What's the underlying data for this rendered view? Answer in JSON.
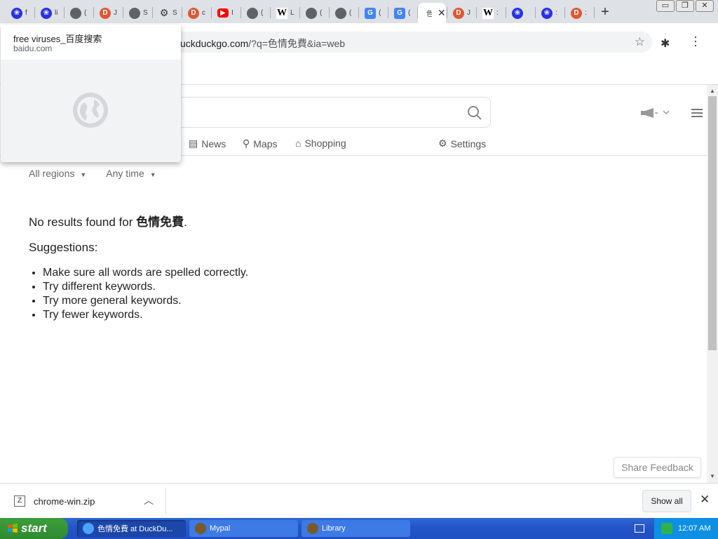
{
  "tabs": [
    {
      "icon": "baidu-paw-icon",
      "title": "f"
    },
    {
      "icon": "baidu-paw-icon",
      "title": "li"
    },
    {
      "icon": "globe-icon",
      "title": "("
    },
    {
      "icon": "duckduckgo-icon",
      "title": "J"
    },
    {
      "icon": "globe-icon",
      "title": "S"
    },
    {
      "icon": "gear-icon",
      "title": "S"
    },
    {
      "icon": "duckduckgo-icon",
      "title": "c"
    },
    {
      "icon": "youtube-icon",
      "title": "I"
    },
    {
      "icon": "globe-icon",
      "title": "("
    },
    {
      "icon": "wikipedia-icon",
      "title": "L"
    },
    {
      "icon": "globe-icon",
      "title": "("
    },
    {
      "icon": "globe-icon",
      "title": "("
    },
    {
      "icon": "google-translate-icon",
      "title": "("
    },
    {
      "icon": "google-translate-icon",
      "title": "("
    },
    {
      "icon": "active-tab",
      "title": "色"
    },
    {
      "icon": "duckduckgo-icon",
      "title": "J"
    },
    {
      "icon": "wikipedia-icon",
      "title": ":"
    },
    {
      "icon": "baidu-paw-icon",
      "title": ""
    },
    {
      "icon": "baidu-paw-icon",
      "title": ":"
    },
    {
      "icon": "duckduckgo-icon",
      "title": ":"
    }
  ],
  "window_controls": {
    "minimize": "▭",
    "restore": "❐",
    "close": "✕"
  },
  "omnibox": {
    "host": "uckduckgo.com",
    "path": "/?q=色情免費&ia=web"
  },
  "hover_card": {
    "title": "free viruses_百度搜索",
    "host": "baidu.com"
  },
  "nav": {
    "news": "News",
    "maps": "Maps",
    "shopping": "Shopping",
    "settings": "Settings"
  },
  "filters": {
    "region": "All regions",
    "time": "Any time"
  },
  "results": {
    "no_results_prefix": "No results found for ",
    "query": "色情免費",
    "no_results_suffix": ".",
    "suggestions_heading": "Suggestions:",
    "suggestions": [
      "Make sure all words are spelled correctly.",
      "Try different keywords.",
      "Try more general keywords.",
      "Try fewer keywords."
    ]
  },
  "share_feedback": "Share Feedback",
  "download": {
    "filename": "chrome-win.zip",
    "show_all": "Show all"
  },
  "taskbar": {
    "start": "start",
    "tasks": [
      {
        "label": "色情免費 at DuckDu...",
        "active": true
      },
      {
        "label": "Mypal",
        "active": false
      },
      {
        "label": "Library",
        "active": false
      }
    ],
    "clock": "12:07 AM"
  },
  "colors": {
    "tabstrip": "#dee1e6",
    "taskbar": "#2456c9",
    "start": "#3c9f3c"
  }
}
